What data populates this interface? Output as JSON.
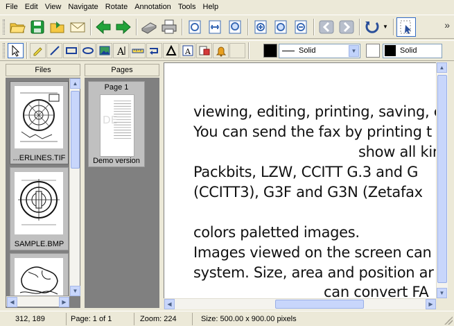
{
  "menu": [
    "File",
    "Edit",
    "View",
    "Navigate",
    "Rotate",
    "Annotation",
    "Tools",
    "Help"
  ],
  "toolbar": {
    "buttons": [
      "open-icon",
      "save-icon",
      "open-folder-icon",
      "email-icon",
      "back-arrow-icon",
      "forward-arrow-icon",
      "scan-icon",
      "print-icon",
      "fit-page-icon",
      "fit-width-icon",
      "fit-height-icon",
      "zoom-in-icon",
      "zoom-fit-icon",
      "zoom-out-icon",
      "prev-page-icon",
      "next-page-icon",
      "rotate-icon",
      "select-mode-icon"
    ],
    "overflow": "»"
  },
  "annotation_toolbar": {
    "tools": [
      "pointer-icon",
      "highlighter-icon",
      "line-icon",
      "rectangle-icon",
      "ellipse-icon",
      "image-icon",
      "text-icon",
      "ruler-icon",
      "arrow-line-icon",
      "polygon-icon",
      "text-box-icon",
      "stamp-icon",
      "bell-icon"
    ],
    "line_color": "#000000",
    "line_style": "Solid",
    "fill_color": "#ffffff",
    "fill_border_color": "#000000",
    "fill_style": "Solid"
  },
  "files_panel": {
    "title": "Files",
    "items": [
      {
        "name": "...ERLINES.TIF"
      },
      {
        "name": "SAMPLE.BMP"
      },
      {
        "name": ""
      }
    ]
  },
  "pages_panel": {
    "title": "Pages",
    "items": [
      {
        "name": "Page 1",
        "caption": "Demo version"
      }
    ]
  },
  "document": {
    "lines": [
      "viewing, editing, printing, saving, c",
      "You can send the fax by printing t",
      "show all kin",
      "Packbits, LZW, CCITT G.3 and G",
      "(CCITT3), G3F and G3N (Zetafax",
      "",
      "colors paletted images.",
      "Images viewed on the screen can",
      "system. Size, area and position ar",
      "can convert FA"
    ]
  },
  "status": {
    "coords": "312, 189",
    "page": "Page: 1 of 1",
    "zoom": "Zoom: 224",
    "size": "Size: 500.00 x 900.00 pixels"
  }
}
